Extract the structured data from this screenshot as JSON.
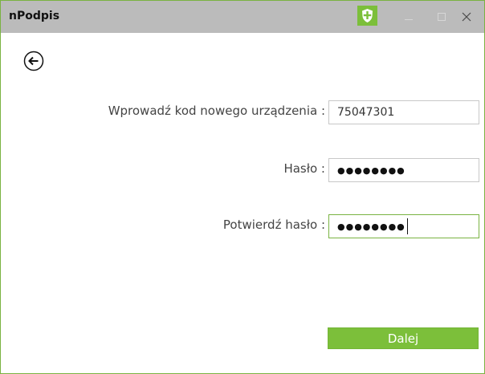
{
  "window": {
    "title": "nPodpis",
    "accent_color": "#7cbf3a",
    "titlebar_color": "#bbbbbb",
    "controls": {
      "minimize_icon": "minimize-icon",
      "maximize_icon": "maximize-icon",
      "close_label": "✕"
    },
    "status_icon": "shield-icon"
  },
  "navigation": {
    "back_icon": "arrow-left-icon"
  },
  "form": {
    "device_code": {
      "label": "Wprowadź kod nowego urządzenia :",
      "value": "75047301"
    },
    "password": {
      "label": "Hasło :",
      "masked_value": "●●●●●●●●"
    },
    "confirm_password": {
      "label": "Potwierdź hasło :",
      "masked_value": "●●●●●●●●"
    },
    "submit_label": "Dalej"
  }
}
